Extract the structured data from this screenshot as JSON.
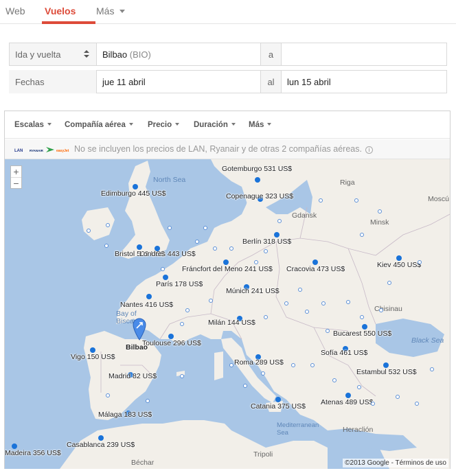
{
  "nav": {
    "web": "Web",
    "flights": "Vuelos",
    "more": "Más"
  },
  "form": {
    "trip_type": "Ida y vuelta",
    "origin": "Bilbao",
    "origin_code": "(BIO)",
    "to_label": "a",
    "destination": "",
    "dates_label": "Fechas",
    "depart_date": "jue 11 abril",
    "date_sep": "al",
    "return_date": "lun 15 abril"
  },
  "filters": [
    {
      "label": "Escalas"
    },
    {
      "label": "Compañía aérea"
    },
    {
      "label": "Precio"
    },
    {
      "label": "Duración"
    },
    {
      "label": "Más"
    }
  ],
  "notice": {
    "text": "No se incluyen los precios de LAN, Ryanair y de otras 2 compañías aéreas.",
    "logos": [
      "LAN",
      "RYANAIR",
      "easyJet"
    ]
  },
  "map": {
    "zoom_in": "+",
    "zoom_out": "−",
    "origin_label": "Bilbao",
    "destinations": [
      {
        "label": "Gotemburgo 531 US$"
      },
      {
        "label": "Edimburgo 445 US$"
      },
      {
        "label": "Copenague 323 US$"
      },
      {
        "label": "Berlín 318 US$"
      },
      {
        "label": "Bristol 509 US$"
      },
      {
        "label": "Londres 443 US$"
      },
      {
        "label": "Fráncfort del Meno 241 US$"
      },
      {
        "label": "Cracovia 473 US$"
      },
      {
        "label": "Kiev 450 US$"
      },
      {
        "label": "París 178 US$"
      },
      {
        "label": "Múnich 241 US$"
      },
      {
        "label": "Nantes 416 US$"
      },
      {
        "label": "Milán 144 US$"
      },
      {
        "label": "Bucarest 550 US$"
      },
      {
        "label": "Toulouse 296 US$"
      },
      {
        "label": "Vigo 150 US$"
      },
      {
        "label": "Sofía 461 US$"
      },
      {
        "label": "Roma 289 US$"
      },
      {
        "label": "Estambul 532 US$"
      },
      {
        "label": "Madrid 82 US$"
      },
      {
        "label": "Atenas 489 US$"
      },
      {
        "label": "Catania 375 US$"
      },
      {
        "label": "Málaga 183 US$"
      },
      {
        "label": "Casablanca 239 US$"
      },
      {
        "label": "Madeira 356 US$"
      }
    ],
    "places": [
      {
        "label": "North Sea"
      },
      {
        "label": "Riga"
      },
      {
        "label": "Moscú"
      },
      {
        "label": "Gdansk"
      },
      {
        "label": "Minsk"
      },
      {
        "label": "Bay of Biscay"
      },
      {
        "label": "Chisinau"
      },
      {
        "label": "Black Sea"
      },
      {
        "label": "Mediterranean Sea"
      },
      {
        "label": "Heraclión"
      },
      {
        "label": "Tripoli"
      },
      {
        "label": "Béchar"
      }
    ],
    "credits": "©2013 Google - Términos de uso"
  },
  "colors": {
    "accent": "#dd4b39",
    "water": "#a9c6e6",
    "land": "#f2efe9",
    "dot": "#1a73d9"
  }
}
